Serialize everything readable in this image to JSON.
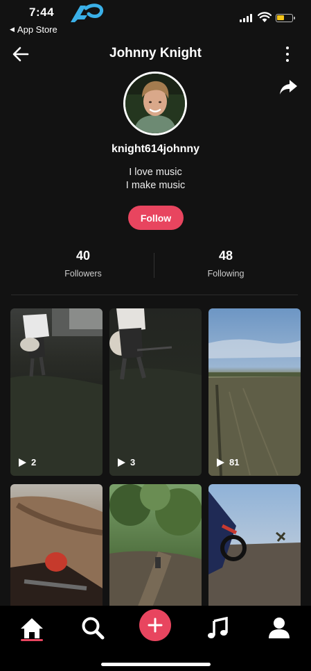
{
  "status_bar": {
    "time": "7:44",
    "back_app_label": "App Store",
    "battery_color": "#f5c518"
  },
  "header": {
    "title": "Johnny Knight",
    "back_icon": "back-arrow-icon",
    "more_icon": "more-vertical-icon",
    "share_icon": "share-icon"
  },
  "profile": {
    "username": "knight614johnny",
    "bio_line_1": "I love music",
    "bio_line_2": "I make music",
    "follow_label": "Follow"
  },
  "stats": {
    "followers_count": "40",
    "followers_label": "Followers",
    "following_count": "48",
    "following_label": "Following"
  },
  "videos": [
    {
      "plays": "2"
    },
    {
      "plays": "3"
    },
    {
      "plays": "81"
    },
    {
      "plays": ""
    },
    {
      "plays": ""
    },
    {
      "plays": ""
    }
  ],
  "bottom_nav": {
    "items": [
      "home-icon",
      "search-icon",
      "add-icon",
      "music-note-icon",
      "profile-icon"
    ],
    "accent_color": "#e8455f"
  }
}
